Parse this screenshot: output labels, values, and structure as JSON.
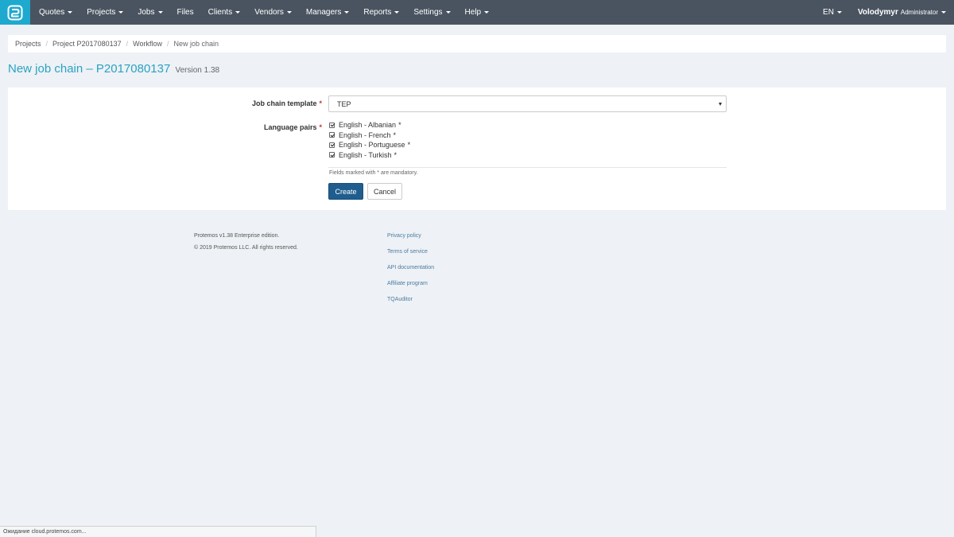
{
  "navbar": {
    "items": [
      {
        "label": "Quotes",
        "has_caret": true
      },
      {
        "label": "Projects",
        "has_caret": true
      },
      {
        "label": "Jobs",
        "has_caret": true
      },
      {
        "label": "Files",
        "has_caret": false
      },
      {
        "label": "Clients",
        "has_caret": true
      },
      {
        "label": "Vendors",
        "has_caret": true
      },
      {
        "label": "Managers",
        "has_caret": true
      },
      {
        "label": "Reports",
        "has_caret": true
      },
      {
        "label": "Settings",
        "has_caret": true
      },
      {
        "label": "Help",
        "has_caret": true
      }
    ],
    "language": "EN",
    "user_name": "Volodymyr",
    "user_role": "Administrator",
    "colors": {
      "bar": "#4a5461",
      "logo": "#1ea9cf"
    }
  },
  "breadcrumb": {
    "items": [
      "Projects",
      "Project P2017080137",
      "Workflow",
      "New job chain"
    ],
    "separator": "/"
  },
  "page": {
    "title": "New job chain – P2017080137",
    "version": "Version 1.38"
  },
  "form": {
    "template_label": "Job chain template",
    "template_value": "TEP",
    "pairs_label": "Language pairs",
    "required_mark": "*",
    "pairs": [
      {
        "label": "English - Albanian",
        "checked": true
      },
      {
        "label": "English - French",
        "checked": true
      },
      {
        "label": "English - Portuguese",
        "checked": true
      },
      {
        "label": "English - Turkish",
        "checked": true
      }
    ],
    "mandatory_note": "Fields marked with * are mandatory.",
    "create_label": "Create",
    "cancel_label": "Cancel"
  },
  "footer": {
    "edition": "Protemos v1.38 Enterprise edition.",
    "copyright": "© 2019 Protemos LLC. All rights reserved.",
    "links": [
      "Privacy policy",
      "Terms of service",
      "API documentation",
      "Affiliate program",
      "TQAuditor"
    ]
  },
  "statusbar": {
    "text": "Ожидание cloud.protemos.com..."
  }
}
